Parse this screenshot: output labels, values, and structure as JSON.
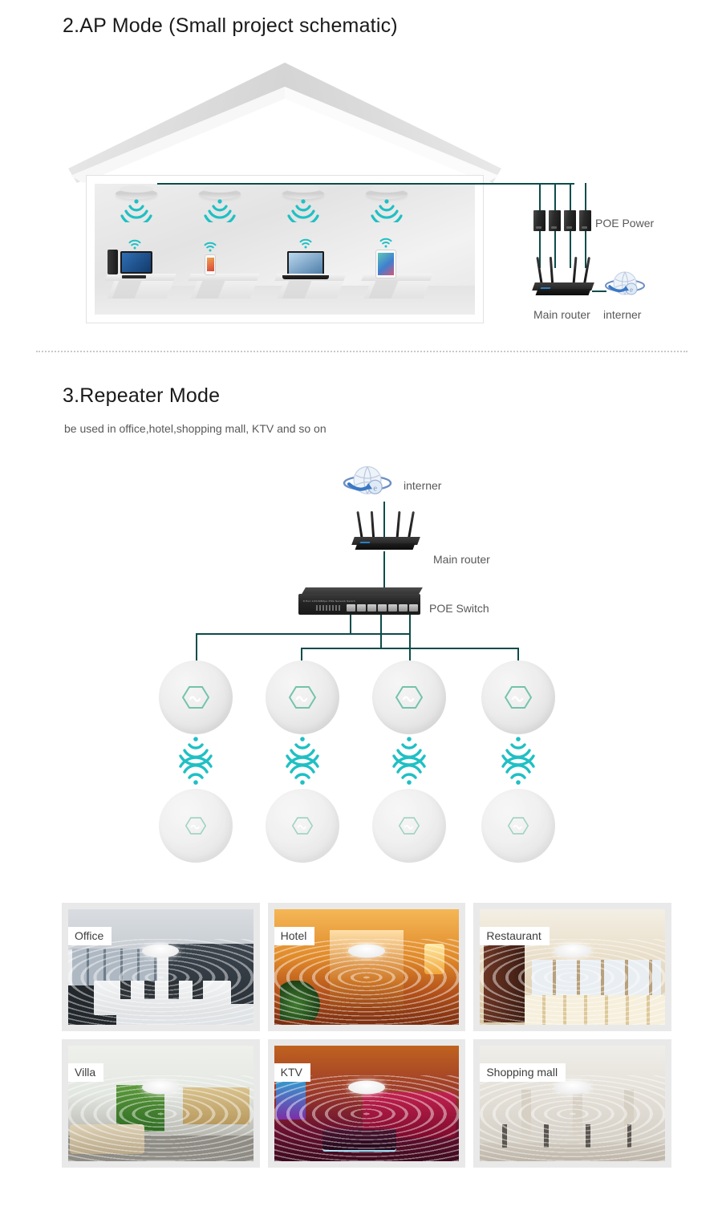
{
  "ap_section": {
    "title": "2.AP Mode (Small project schematic)",
    "labels": {
      "poe_power": "POE Power",
      "main_router": "Main router",
      "internet": "interner"
    },
    "ceiling_ap_count": 4,
    "poe_injector_count": 4,
    "devices": [
      "desktop-computer",
      "smartphone",
      "laptop",
      "tablet"
    ]
  },
  "repeater_section": {
    "title": "3.Repeater Mode",
    "subtitle": "be used in office,hotel,shopping mall, KTV and so on",
    "labels": {
      "internet": "interner",
      "main_router": "Main router",
      "poe_switch": "POE Switch"
    },
    "ap_rows": 2,
    "ap_per_row": 4
  },
  "gallery": {
    "items": [
      {
        "caption": "Office",
        "scene": "sc-office"
      },
      {
        "caption": "Hotel",
        "scene": "sc-hotel"
      },
      {
        "caption": "Restaurant",
        "scene": "sc-rest"
      },
      {
        "caption": "Villa",
        "scene": "sc-villa"
      },
      {
        "caption": "KTV",
        "scene": "sc-ktv"
      },
      {
        "caption": "Shopping mall",
        "scene": "sc-mall"
      }
    ]
  },
  "colors": {
    "wifi_teal": "#1fc0c4",
    "cable": "#0c4c4a",
    "hex_logo": "#74c3ab",
    "heading": "#1a1a1a",
    "body_text": "#585858",
    "card_frame": "#e9e9e9"
  }
}
